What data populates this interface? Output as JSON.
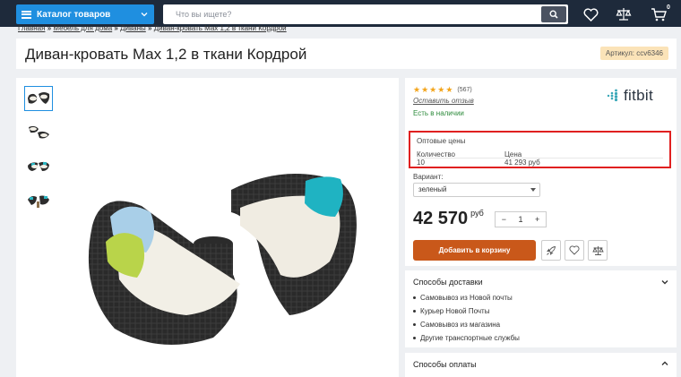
{
  "header": {
    "catalog_label": "Каталог товаров",
    "search_placeholder": "Что вы ищете?",
    "cart_count": "0"
  },
  "breadcrumbs": [
    "Главная",
    "Мебель для дома",
    "Диваны",
    "Диван-кровать Max 1,2 в ткани Кордрой"
  ],
  "breadcrumb_sep": "»",
  "product": {
    "title": "Диван-кровать Max 1,2 в ткани Кордрой",
    "sku_label": "Артикул: ccv6346",
    "rating_stars": 5,
    "reviews_count": "(567)",
    "leave_review": "Оставить отзыв",
    "availability": "Есть в наличии",
    "brand": "fitbit",
    "price": "42 570",
    "currency": "руб",
    "quantity": "1",
    "qty_minus": "−",
    "qty_plus": "+",
    "add_to_cart": "Добавить в корзину"
  },
  "wholesale": {
    "title": "Оптовые цены",
    "col_qty": "Количество",
    "col_price": "Цена",
    "row_qty": "10",
    "row_price": "41 293 руб"
  },
  "variant": {
    "label": "Вариант:",
    "selected": "зеленый"
  },
  "delivery": {
    "title": "Способы доставки",
    "items": [
      "Самовывоз из Новой почты",
      "Курьер Новой Почты",
      "Самовывоз из магазина",
      "Другие транспортные службы"
    ]
  },
  "payment": {
    "title": "Способы оплаты"
  },
  "colors": {
    "topbar": "#1e2a3b",
    "accent": "#1f8fe0",
    "add_button": "#c9581a",
    "highlight_border": "#e02020",
    "stars": "#f3a51c",
    "in_stock": "#2e8b3c"
  }
}
